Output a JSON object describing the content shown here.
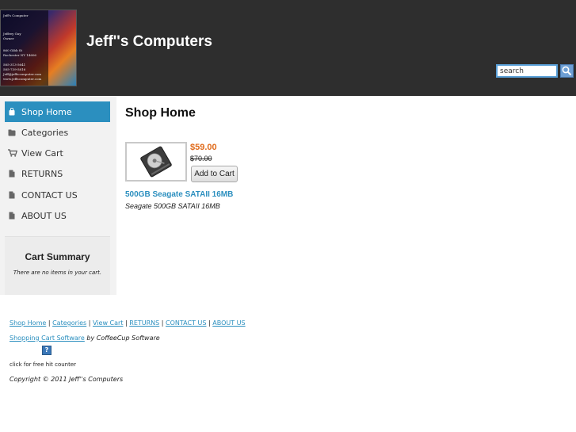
{
  "header": {
    "site_title": "Jeff''s Computers",
    "logo": {
      "lines": [
        "Jeff's Computer",
        "Jeffrey Guy",
        "Owner",
        "860 Gibb St",
        "Rochester NY 14606",
        "585-313-5641",
        "585-739-5816",
        "Jeff@jeffscomputer.com",
        "www.jeffscomputer.com"
      ]
    },
    "search": {
      "value": "search"
    }
  },
  "sidebar": {
    "items": [
      {
        "label": "Shop Home",
        "icon": "bag-icon",
        "active": true
      },
      {
        "label": "Categories",
        "icon": "folder-icon",
        "active": false
      },
      {
        "label": "View Cart",
        "icon": "cart-icon",
        "active": false
      },
      {
        "label": "RETURNS",
        "icon": "page-icon",
        "active": false
      },
      {
        "label": "CONTACT US",
        "icon": "page-icon",
        "active": false
      },
      {
        "label": "ABOUT US",
        "icon": "page-icon",
        "active": false
      }
    ],
    "cart_summary": {
      "title": "Cart Summary",
      "empty_text": "There are no items in your cart."
    }
  },
  "main": {
    "title": "Shop Home",
    "product": {
      "sale_price": "$59.00",
      "old_price": "$70.00",
      "button": "Add to Cart",
      "name": "500GB Seagate SATAII 16MB",
      "description": "Seagate 500GB SATAII 16MB",
      "image_icon": "hard-drive-icon"
    }
  },
  "footer": {
    "links": [
      "Shop Home",
      "Categories",
      "View Cart",
      "RETURNS",
      "CONTACT US",
      "ABOUT US"
    ],
    "separator": "|",
    "powered_link": "Shopping Cart Software",
    "powered_suffix": " by CoffeeCup Software",
    "counter_icon": "?",
    "counter_text": "click for free hit counter",
    "copyright": "Copyright © 2011 Jeff''s Computers"
  },
  "colors": {
    "header_bg": "#2e2e2e",
    "accent": "#2b8fbf",
    "sale": "#e06a1a",
    "sidebar_bg": "#f2f2f2"
  }
}
